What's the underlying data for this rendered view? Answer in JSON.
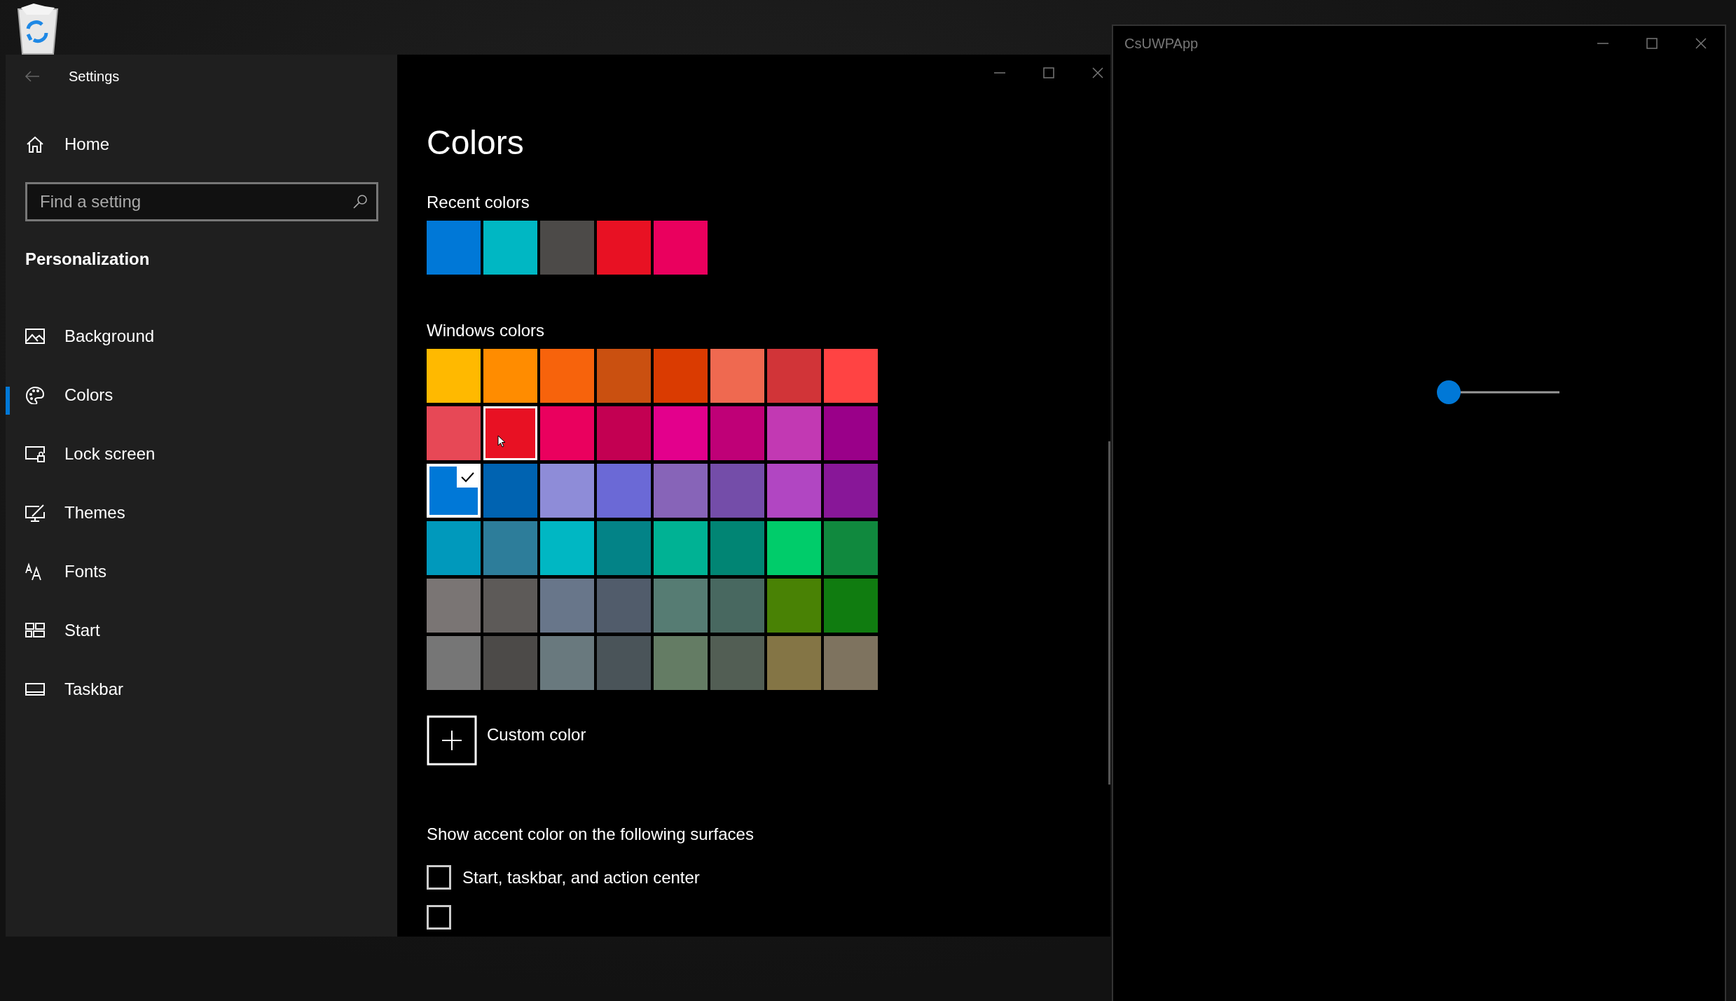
{
  "settings_window": {
    "title": "Settings",
    "sidebar": {
      "home": "Home",
      "search": {
        "placeholder": "Find a setting"
      },
      "section": "Personalization",
      "items": [
        {
          "label": "Background",
          "selected": false
        },
        {
          "label": "Colors",
          "selected": true
        },
        {
          "label": "Lock screen",
          "selected": false
        },
        {
          "label": "Themes",
          "selected": false
        },
        {
          "label": "Fonts",
          "selected": false
        },
        {
          "label": "Start",
          "selected": false
        },
        {
          "label": "Taskbar",
          "selected": false
        }
      ]
    },
    "content": {
      "heading": "Colors",
      "recent_label": "Recent colors",
      "recent_colors": [
        {
          "color": "#0078d7"
        },
        {
          "color": "#00b7c3"
        },
        {
          "color": "#4c4a48"
        },
        {
          "color": "#e81123"
        },
        {
          "color": "#ea005e"
        }
      ],
      "windows_label": "Windows colors",
      "windows_colors": [
        {
          "color": "#ffb900",
          "selected": false,
          "hovered": false
        },
        {
          "color": "#ff8c00",
          "selected": false,
          "hovered": false
        },
        {
          "color": "#f7630c",
          "selected": false,
          "hovered": false
        },
        {
          "color": "#ca5010",
          "selected": false,
          "hovered": false
        },
        {
          "color": "#da3b01",
          "selected": false,
          "hovered": false
        },
        {
          "color": "#ef6950",
          "selected": false,
          "hovered": false
        },
        {
          "color": "#d13438",
          "selected": false,
          "hovered": false
        },
        {
          "color": "#ff4343",
          "selected": false,
          "hovered": false
        },
        {
          "color": "#e74856",
          "selected": false,
          "hovered": false
        },
        {
          "color": "#e81123",
          "selected": false,
          "hovered": true
        },
        {
          "color": "#ea005e",
          "selected": false,
          "hovered": false
        },
        {
          "color": "#c30052",
          "selected": false,
          "hovered": false
        },
        {
          "color": "#e3008c",
          "selected": false,
          "hovered": false
        },
        {
          "color": "#bf0077",
          "selected": false,
          "hovered": false
        },
        {
          "color": "#c239b3",
          "selected": false,
          "hovered": false
        },
        {
          "color": "#9a0089",
          "selected": false,
          "hovered": false
        },
        {
          "color": "#0078d7",
          "selected": true,
          "hovered": false
        },
        {
          "color": "#0063b1",
          "selected": false,
          "hovered": false
        },
        {
          "color": "#8e8cd8",
          "selected": false,
          "hovered": false
        },
        {
          "color": "#6b69d6",
          "selected": false,
          "hovered": false
        },
        {
          "color": "#8764b8",
          "selected": false,
          "hovered": false
        },
        {
          "color": "#744da9",
          "selected": false,
          "hovered": false
        },
        {
          "color": "#b146c2",
          "selected": false,
          "hovered": false
        },
        {
          "color": "#881798",
          "selected": false,
          "hovered": false
        },
        {
          "color": "#0099bc",
          "selected": false,
          "hovered": false
        },
        {
          "color": "#2d7d9a",
          "selected": false,
          "hovered": false
        },
        {
          "color": "#00b7c3",
          "selected": false,
          "hovered": false
        },
        {
          "color": "#038387",
          "selected": false,
          "hovered": false
        },
        {
          "color": "#00b294",
          "selected": false,
          "hovered": false
        },
        {
          "color": "#018574",
          "selected": false,
          "hovered": false
        },
        {
          "color": "#00cc6a",
          "selected": false,
          "hovered": false
        },
        {
          "color": "#10893e",
          "selected": false,
          "hovered": false
        },
        {
          "color": "#7a7574",
          "selected": false,
          "hovered": false
        },
        {
          "color": "#5d5a58",
          "selected": false,
          "hovered": false
        },
        {
          "color": "#68768a",
          "selected": false,
          "hovered": false
        },
        {
          "color": "#515c6b",
          "selected": false,
          "hovered": false
        },
        {
          "color": "#567c73",
          "selected": false,
          "hovered": false
        },
        {
          "color": "#486860",
          "selected": false,
          "hovered": false
        },
        {
          "color": "#498205",
          "selected": false,
          "hovered": false
        },
        {
          "color": "#107c10",
          "selected": false,
          "hovered": false
        },
        {
          "color": "#767676",
          "selected": false,
          "hovered": false
        },
        {
          "color": "#4c4a48",
          "selected": false,
          "hovered": false
        },
        {
          "color": "#69797e",
          "selected": false,
          "hovered": false
        },
        {
          "color": "#4a5459",
          "selected": false,
          "hovered": false
        },
        {
          "color": "#647c64",
          "selected": false,
          "hovered": false
        },
        {
          "color": "#525e54",
          "selected": false,
          "hovered": false
        },
        {
          "color": "#847545",
          "selected": false,
          "hovered": false
        },
        {
          "color": "#7e735f",
          "selected": false,
          "hovered": false
        }
      ],
      "custom_color": "Custom color",
      "surfaces_label": "Show accent color on the following surfaces",
      "checkboxes": [
        {
          "label": "Start, taskbar, and action center",
          "checked": false
        },
        {
          "checked": false
        }
      ]
    }
  },
  "app_window": {
    "title": "CsUWPApp",
    "slider": {
      "level": 0
    }
  }
}
